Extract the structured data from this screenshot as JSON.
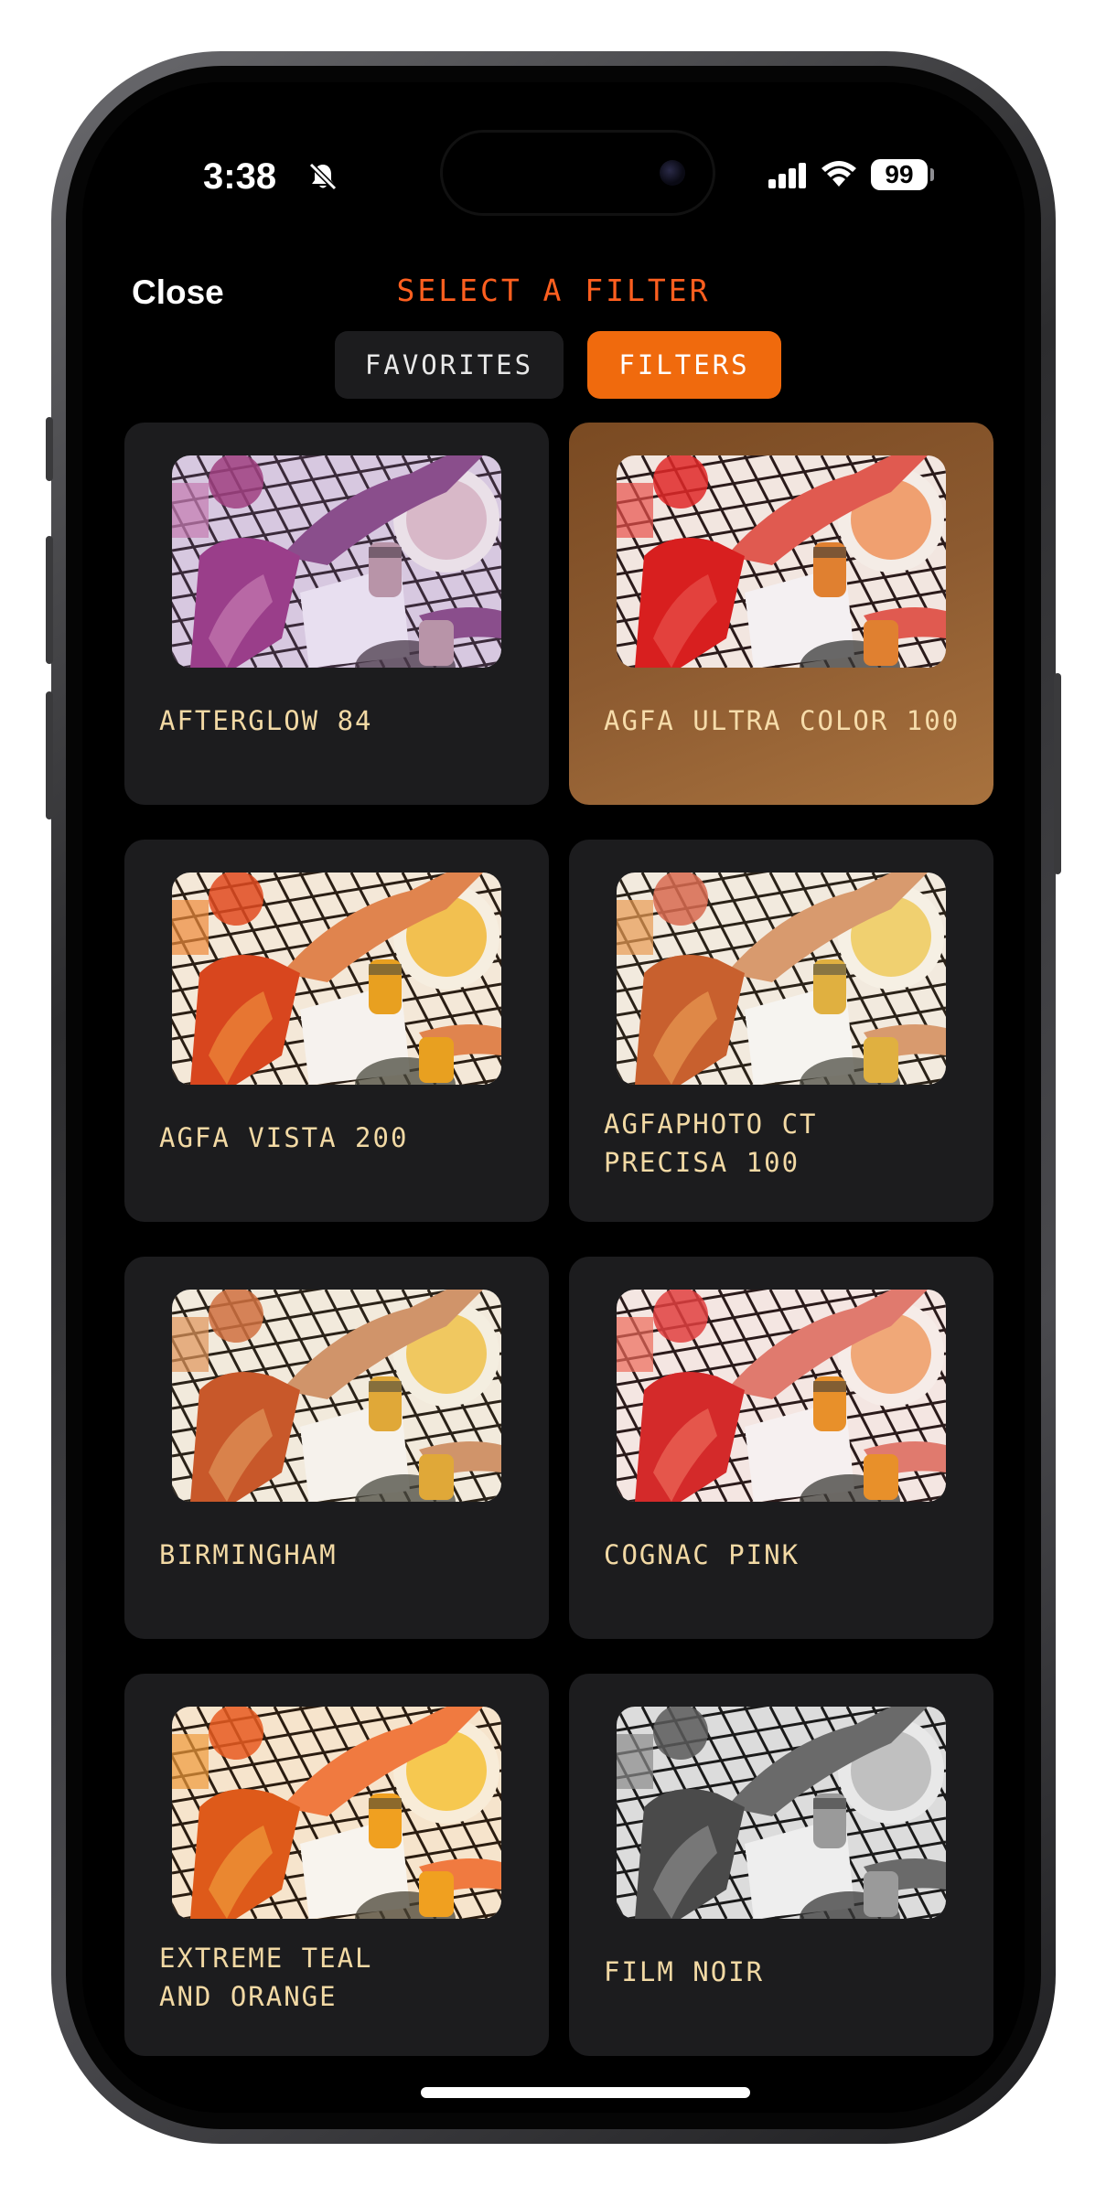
{
  "status_bar": {
    "time": "3:38",
    "battery": "99"
  },
  "header": {
    "close_label": "Close",
    "title": "SELECT A FILTER"
  },
  "tabs": [
    {
      "label": "FAVORITES",
      "active": false
    },
    {
      "label": "FILTERS",
      "active": true
    }
  ],
  "filters": [
    {
      "name": "AFTERGLOW 84",
      "selected": false,
      "tone": "purple"
    },
    {
      "name": "AGFA ULTRA COLOR 100",
      "selected": true,
      "tone": "red"
    },
    {
      "name": "AGFA VISTA 200",
      "selected": false,
      "tone": "warm"
    },
    {
      "name": "AGFAPHOTO CT\nPRECISA 100",
      "selected": false,
      "tone": "golden"
    },
    {
      "name": "BIRMINGHAM",
      "selected": false,
      "tone": "natural"
    },
    {
      "name": "COGNAC PINK",
      "selected": false,
      "tone": "pink"
    },
    {
      "name": "EXTREME TEAL\nAND ORANGE",
      "selected": false,
      "tone": "orange"
    },
    {
      "name": "FILM NOIR",
      "selected": false,
      "tone": "mono"
    }
  ],
  "colors": {
    "accent": "#f06a0d",
    "title": "#ff5f1f",
    "label": "#f2d9a4",
    "card": "#1c1c1e"
  },
  "icons": {
    "mute": "bell-slash-icon",
    "signal": "cellular-signal-icon",
    "wifi": "wifi-icon",
    "battery": "battery-icon"
  }
}
